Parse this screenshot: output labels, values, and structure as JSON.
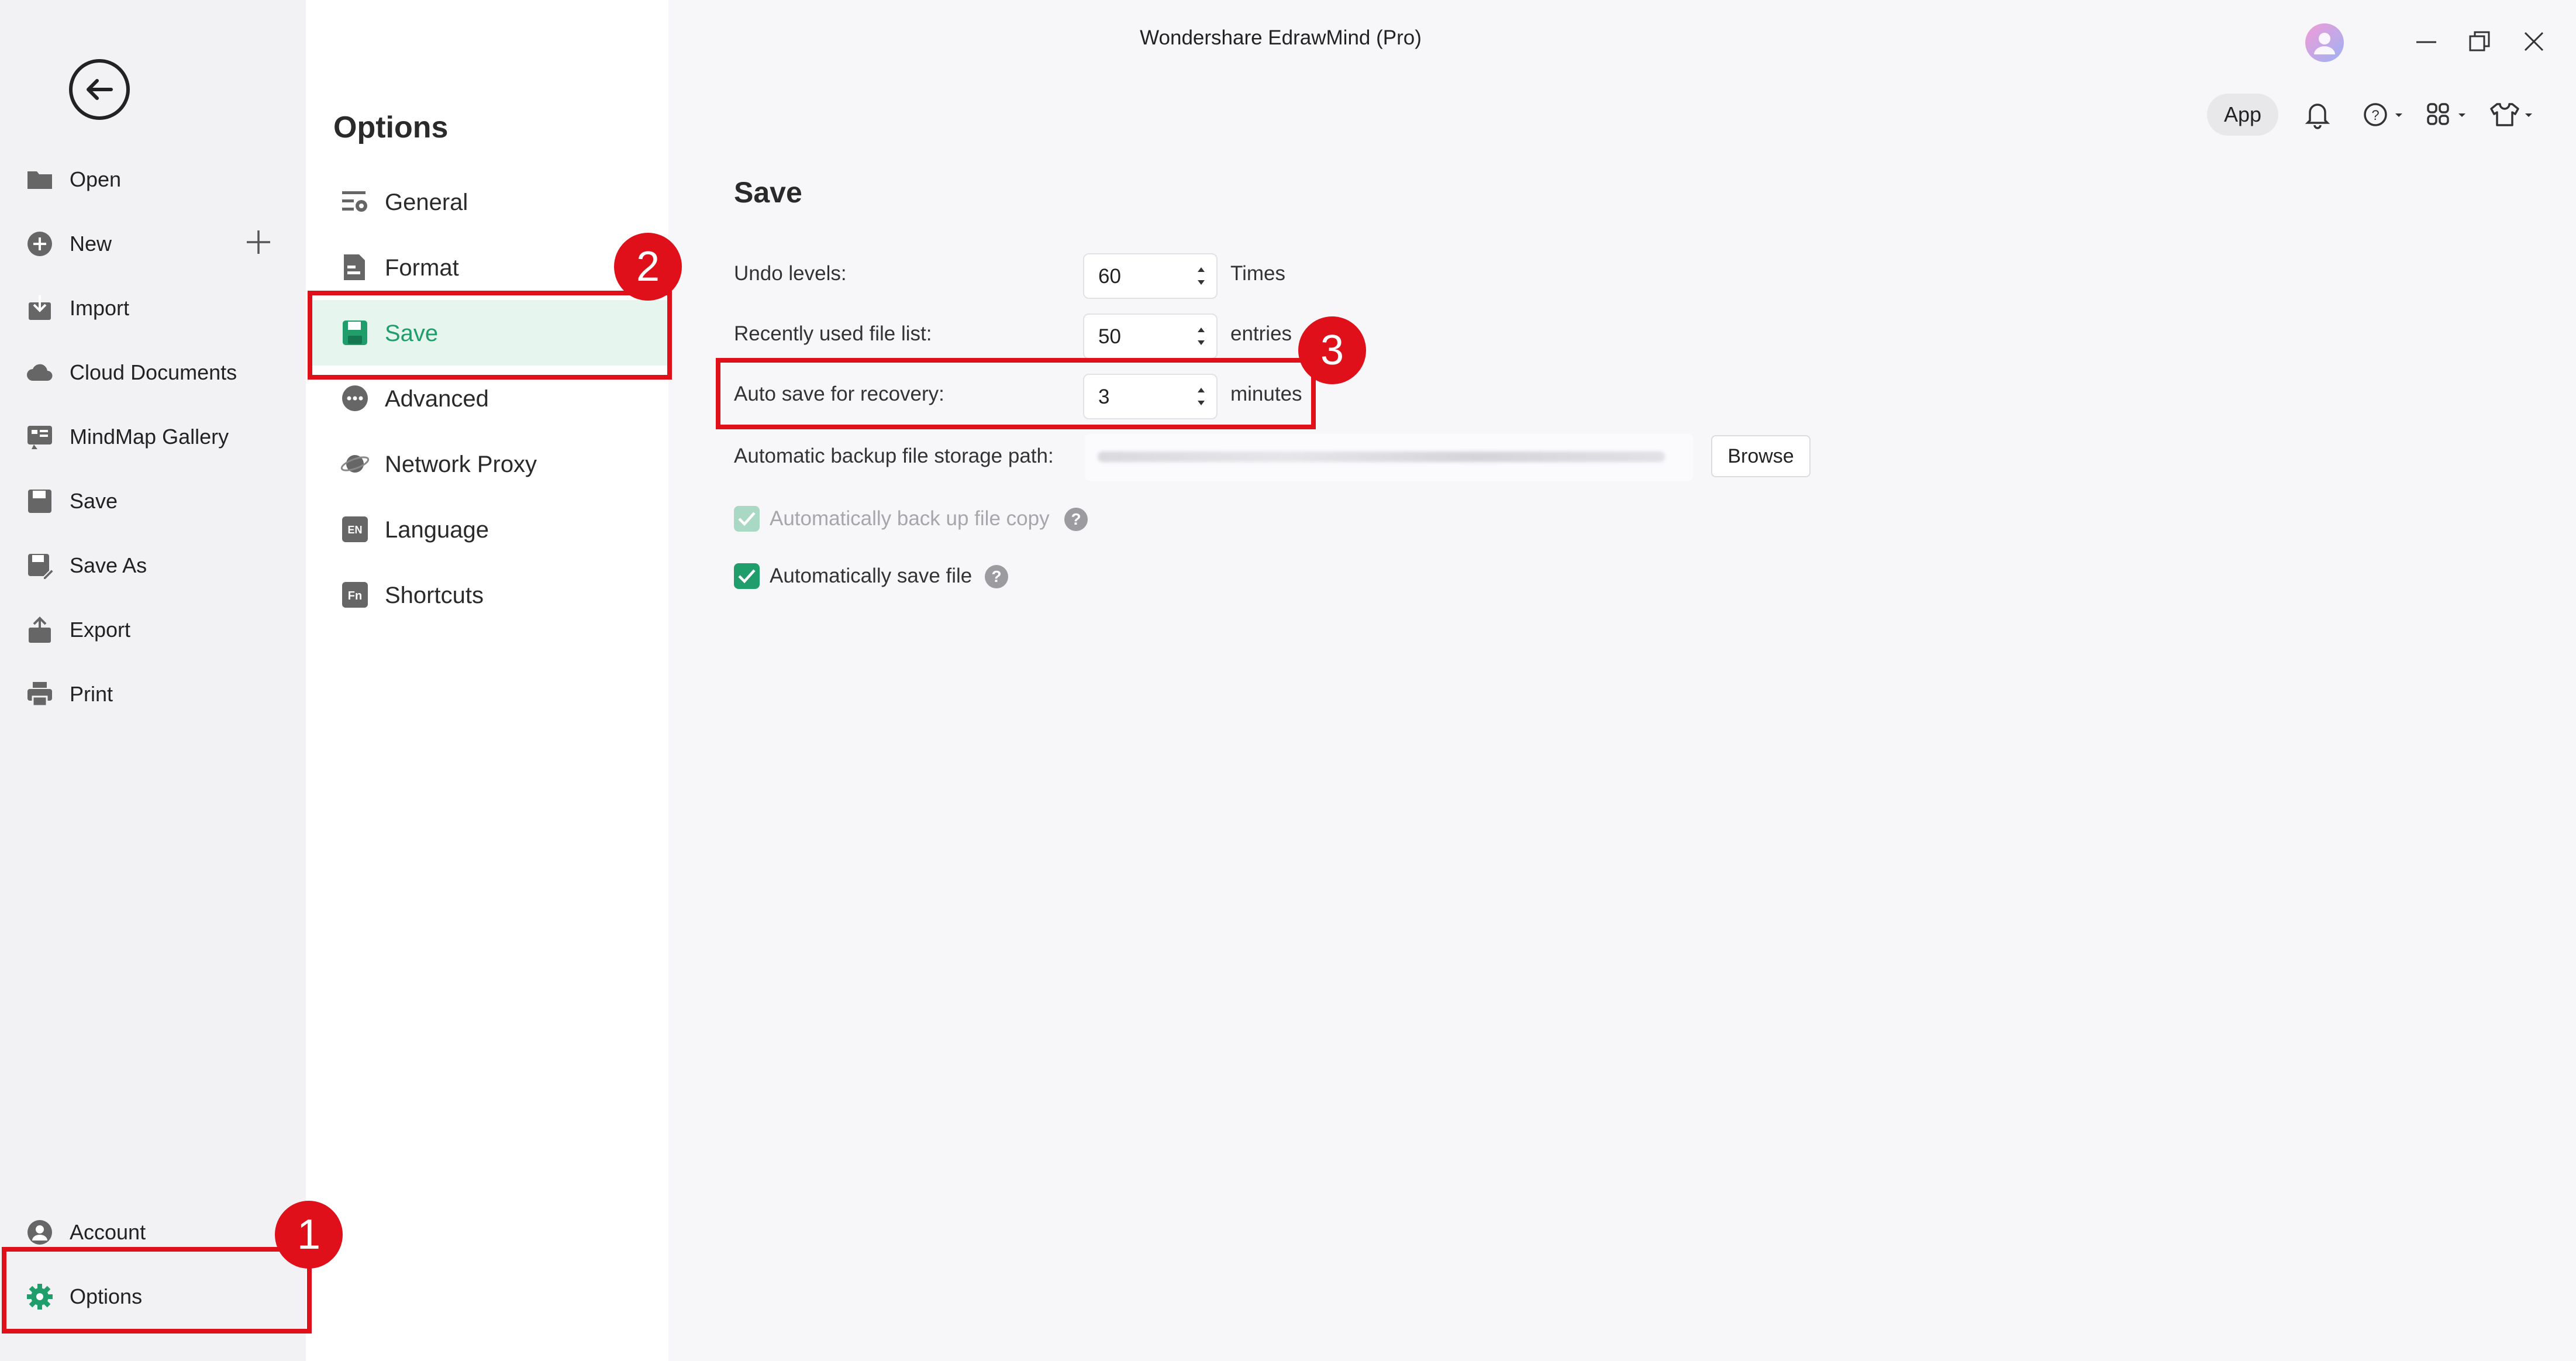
{
  "window": {
    "title": "Wondershare EdrawMind (Pro)"
  },
  "toolbar": {
    "app_label": "App"
  },
  "leftnav": {
    "items": [
      {
        "label": "Open",
        "icon": "folder-icon"
      },
      {
        "label": "New",
        "icon": "plus-circle-icon"
      },
      {
        "label": "Import",
        "icon": "import-icon"
      },
      {
        "label": "Cloud Documents",
        "icon": "cloud-icon"
      },
      {
        "label": "MindMap Gallery",
        "icon": "gallery-icon"
      },
      {
        "label": "Save",
        "icon": "save-icon"
      },
      {
        "label": "Save As",
        "icon": "save-as-icon"
      },
      {
        "label": "Export",
        "icon": "export-icon"
      },
      {
        "label": "Print",
        "icon": "print-icon"
      }
    ],
    "account_label": "Account",
    "options_label": "Options"
  },
  "options": {
    "title": "Options",
    "items": [
      {
        "label": "General",
        "icon": "general-icon"
      },
      {
        "label": "Format",
        "icon": "format-icon"
      },
      {
        "label": "Save",
        "icon": "save-icon",
        "active": true
      },
      {
        "label": "Advanced",
        "icon": "advanced-icon"
      },
      {
        "label": "Network Proxy",
        "icon": "network-icon"
      },
      {
        "label": "Language",
        "icon": "language-icon"
      },
      {
        "label": "Shortcuts",
        "icon": "shortcuts-icon"
      }
    ]
  },
  "save": {
    "title": "Save",
    "undo": {
      "label": "Undo levels:",
      "value": "60",
      "unit": "Times"
    },
    "recent": {
      "label": "Recently used file list:",
      "value": "50",
      "unit": "entries"
    },
    "autosave": {
      "label": "Auto save for recovery:",
      "value": "3",
      "unit": "minutes"
    },
    "backup_path": {
      "label": "Automatic backup file storage path:",
      "browse": "Browse"
    },
    "backup_copy": {
      "label": "Automatically back up file copy",
      "checked": true,
      "disabled": true
    },
    "auto_save_file": {
      "label": "Automatically save file",
      "checked": true
    }
  },
  "annotations": {
    "one": "1",
    "two": "2",
    "three": "3"
  },
  "colors": {
    "accent": "#1f9d6b",
    "annotation": "#e0101a"
  }
}
